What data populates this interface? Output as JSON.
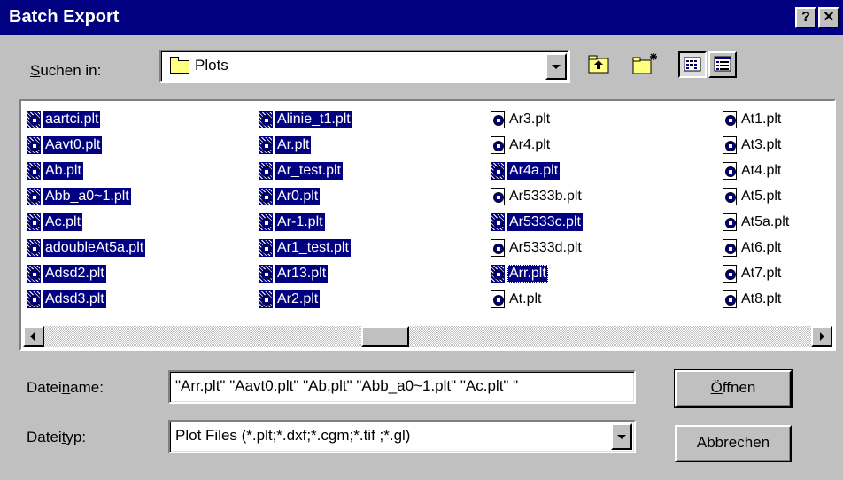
{
  "window": {
    "title": "Batch Export",
    "help_label": "?",
    "close_label": "✕"
  },
  "lookin": {
    "label_prefix": "",
    "label_accel": "S",
    "label_rest": "uchen in:",
    "value": "Plots",
    "folder_icon": "folder-icon"
  },
  "toolbar": {
    "up_icon": "up-folder-icon",
    "new_folder_icon": "new-folder-icon",
    "list_view_icon": "list-view-icon",
    "details_view_icon": "details-view-icon"
  },
  "files": {
    "columns": [
      [
        {
          "name": "aartci.plt",
          "selected": true
        },
        {
          "name": "Aavt0.plt",
          "selected": true
        },
        {
          "name": "Ab.plt",
          "selected": true
        },
        {
          "name": "Abb_a0~1.plt",
          "selected": true
        },
        {
          "name": "Ac.plt",
          "selected": true
        },
        {
          "name": "adoubleAt5a.plt",
          "selected": true
        },
        {
          "name": "Adsd2.plt",
          "selected": true
        },
        {
          "name": "Adsd3.plt",
          "selected": true
        }
      ],
      [
        {
          "name": "Alinie_t1.plt",
          "selected": true
        },
        {
          "name": "Ar.plt",
          "selected": true
        },
        {
          "name": "Ar_test.plt",
          "selected": true
        },
        {
          "name": "Ar0.plt",
          "selected": true
        },
        {
          "name": "Ar-1.plt",
          "selected": true
        },
        {
          "name": "Ar1_test.plt",
          "selected": true
        },
        {
          "name": "Ar13.plt",
          "selected": true
        },
        {
          "name": "Ar2.plt",
          "selected": true
        }
      ],
      [
        {
          "name": "Ar3.plt",
          "selected": false
        },
        {
          "name": "Ar4.plt",
          "selected": false
        },
        {
          "name": "Ar4a.plt",
          "selected": true
        },
        {
          "name": "Ar5333b.plt",
          "selected": false
        },
        {
          "name": "Ar5333c.plt",
          "selected": true
        },
        {
          "name": "Ar5333d.plt",
          "selected": false
        },
        {
          "name": "Arr.plt",
          "selected": true,
          "focus": true
        },
        {
          "name": "At.plt",
          "selected": false
        }
      ],
      [
        {
          "name": "At1.plt",
          "selected": false
        },
        {
          "name": "At3.plt",
          "selected": false
        },
        {
          "name": "At4.plt",
          "selected": false
        },
        {
          "name": "At5.plt",
          "selected": false
        },
        {
          "name": "At5a.plt",
          "selected": false
        },
        {
          "name": "At6.plt",
          "selected": false
        },
        {
          "name": "At7.plt",
          "selected": false
        },
        {
          "name": "At8.plt",
          "selected": false
        }
      ]
    ],
    "file_icon": "plot-file-icon"
  },
  "filename": {
    "label_prefix": "Datei",
    "label_accel": "n",
    "label_rest": "ame:",
    "value": "\"Arr.plt\" \"Aavt0.plt\" \"Ab.plt\" \"Abb_a0~1.plt\" \"Ac.plt\" \""
  },
  "filetype": {
    "label_prefix": "Datei",
    "label_accel": "t",
    "label_rest": "yp:",
    "value": "Plot Files (*.plt;*.dxf;*.cgm;*.tif ;*.gl)"
  },
  "buttons": {
    "open_accel": "Ö",
    "open_rest": "ffnen",
    "cancel": "Abbrechen"
  },
  "colors": {
    "titlebar": "#000080",
    "dialog_bg": "#c0c0c0",
    "selection": "#000080"
  }
}
